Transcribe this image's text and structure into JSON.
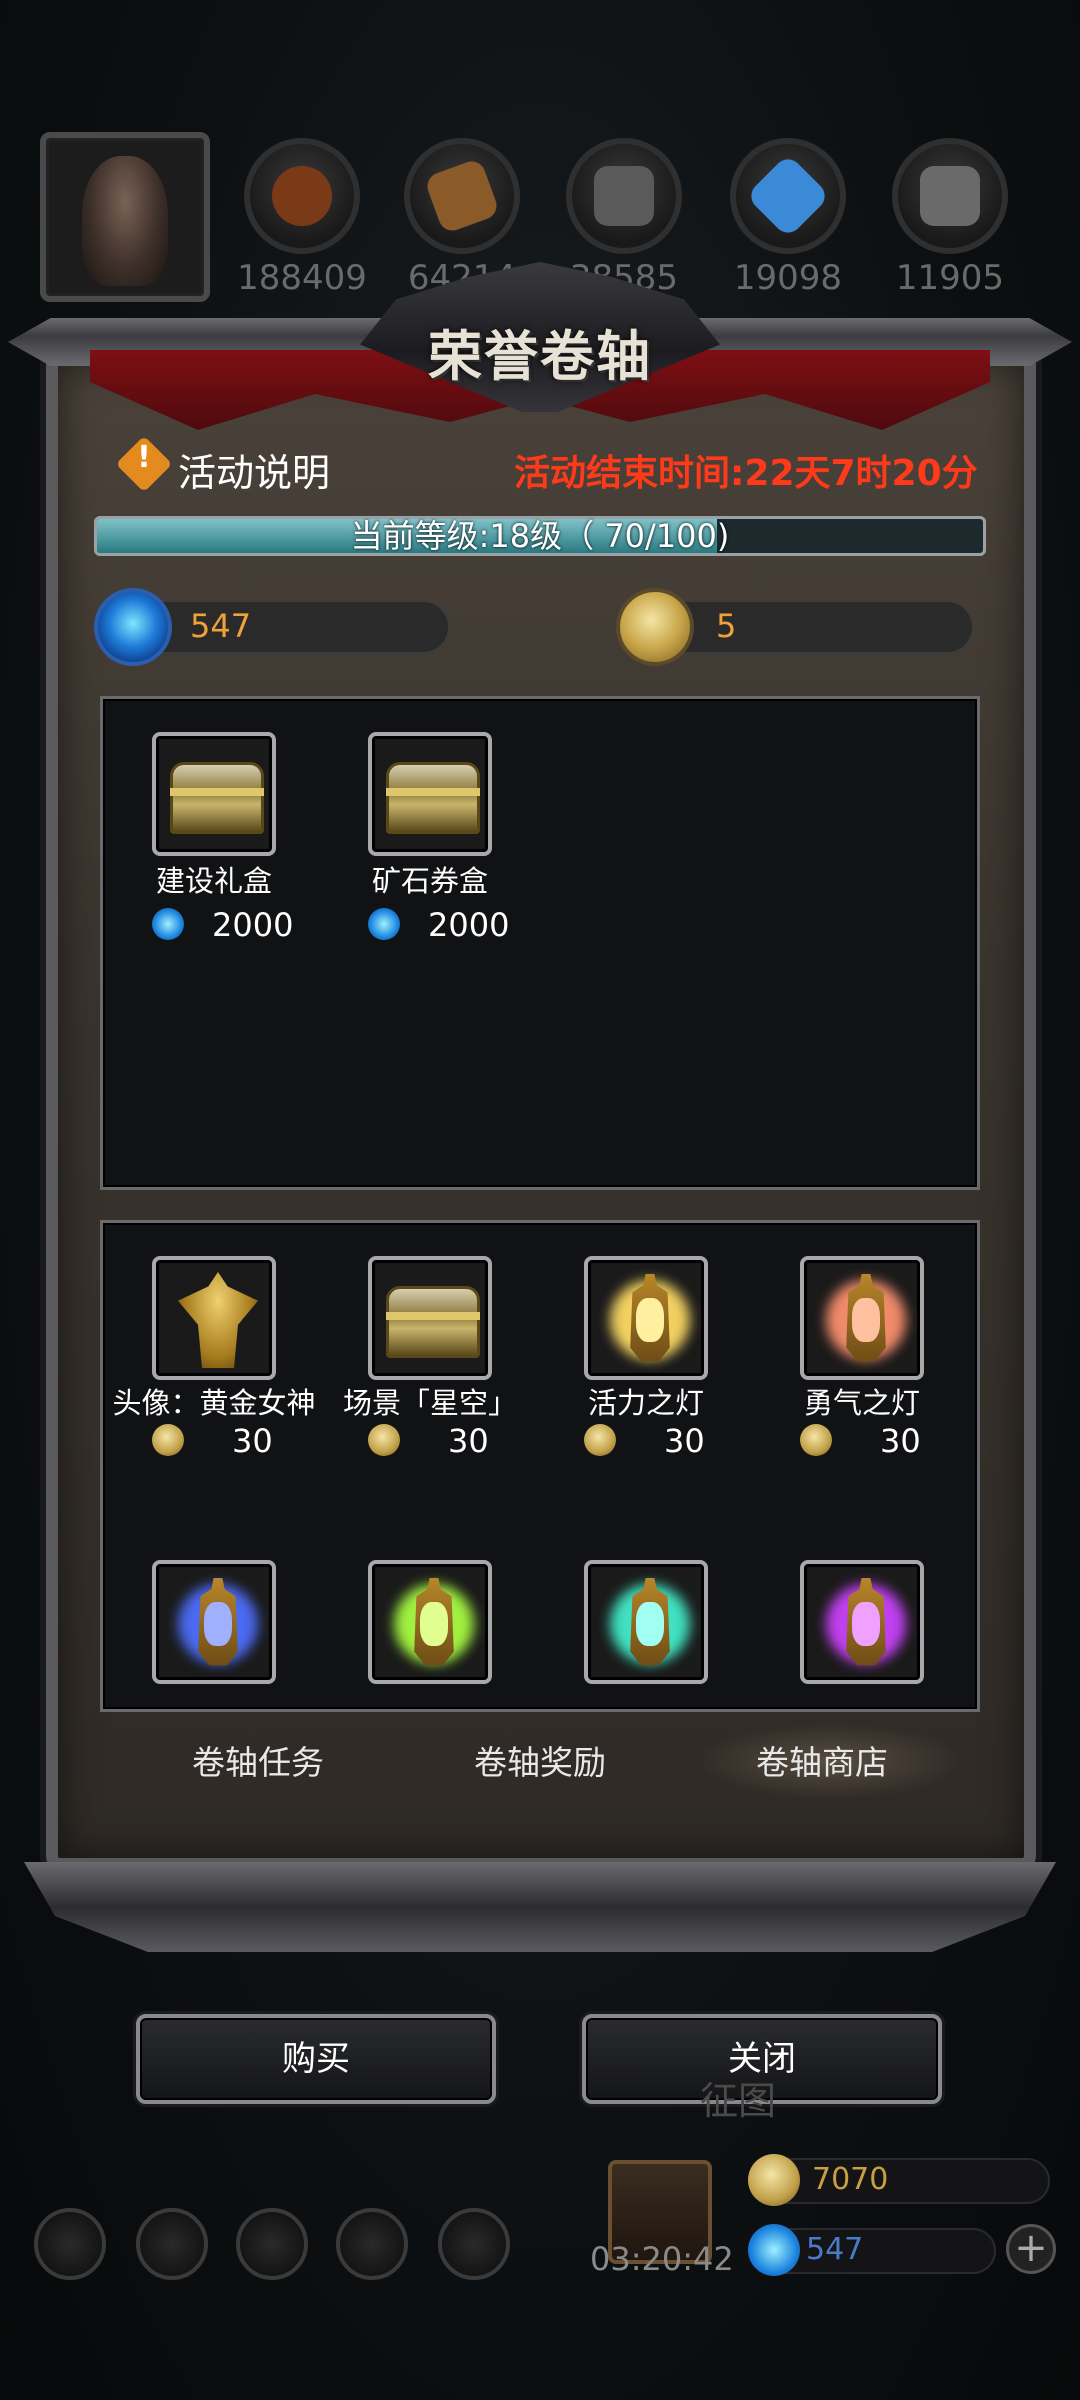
{
  "hud": {
    "resources": [
      {
        "icon": "meat-icon",
        "value": "188409",
        "color": "#7a3a18"
      },
      {
        "icon": "wood-icon",
        "value": "64214",
        "color": "#8a5a28"
      },
      {
        "icon": "stone-icon",
        "value": "38585",
        "color": "#5a5a5a"
      },
      {
        "icon": "crystal-icon",
        "value": "19098",
        "color": "#3a8ad8"
      },
      {
        "icon": "iron-icon",
        "value": "11905",
        "color": "#6a6a6a"
      }
    ],
    "timer": "03:20:42",
    "gold": "7070",
    "gems": "547"
  },
  "dialog": {
    "title": "荣誉卷轴",
    "info_label": "活动说明",
    "end_time": "活动结束时间:22天7时20分",
    "level_text": "当前等级:18级（ 70/100)",
    "level_progress": 0.7,
    "currency": {
      "gems": "547",
      "coins": "5"
    },
    "gem_shop": [
      {
        "name": "建设礼盒",
        "price": "2000",
        "icon": "chest-icon"
      },
      {
        "name": "矿石券盒",
        "price": "2000",
        "icon": "chest-icon"
      }
    ],
    "coin_shop": [
      {
        "name": "头像：黄金女神",
        "price": "30",
        "icon": "golden-goddess-icon"
      },
      {
        "name": "场景「星空」",
        "price": "30",
        "icon": "chest-icon"
      },
      {
        "name": "活力之灯",
        "price": "30",
        "icon": "lamp-icon",
        "glow": "#f0d060"
      },
      {
        "name": "勇气之灯",
        "price": "30",
        "icon": "lamp-icon",
        "glow": "#f08a6a"
      },
      {
        "name": "",
        "price": "",
        "icon": "lamp-icon",
        "glow": "#4a6af0"
      },
      {
        "name": "",
        "price": "",
        "icon": "lamp-icon",
        "glow": "#a0f040"
      },
      {
        "name": "",
        "price": "",
        "icon": "lamp-icon",
        "glow": "#40e0c0"
      },
      {
        "name": "",
        "price": "",
        "icon": "lamp-icon",
        "glow": "#c040f0"
      }
    ],
    "tabs": [
      "卷轴任务",
      "卷轴奖励",
      "卷轴商店"
    ],
    "active_tab": 2
  },
  "buttons": {
    "buy": "购买",
    "close": "关闭"
  },
  "background_text": "征图"
}
